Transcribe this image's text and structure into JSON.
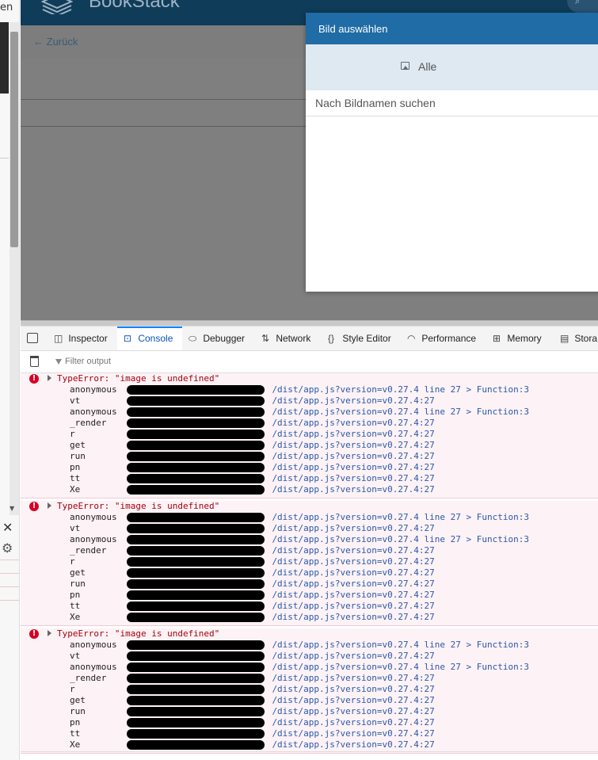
{
  "left_window": {
    "partial_label": "en",
    "close_glyph": "✕",
    "settings_glyph": "⚙"
  },
  "bookstack": {
    "app_title": "BookStack",
    "search_glyph": "⌕",
    "back_label": "Zurück",
    "back_arrow": "←"
  },
  "modal": {
    "title": "Bild auswählen",
    "tab_label": "Alle",
    "tab_icon": "image-icon",
    "search_placeholder": "Nach Bildnamen suchen"
  },
  "devtools": {
    "tabs": [
      {
        "label": "Inspector",
        "icon": "inspector-icon",
        "glyph": "◫"
      },
      {
        "label": "Console",
        "icon": "console-icon",
        "glyph": "⊡"
      },
      {
        "label": "Debugger",
        "icon": "debugger-icon",
        "glyph": "⬭"
      },
      {
        "label": "Network",
        "icon": "network-icon",
        "glyph": "⇅"
      },
      {
        "label": "Style Editor",
        "icon": "style-editor-icon",
        "glyph": "{}"
      },
      {
        "label": "Performance",
        "icon": "performance-icon",
        "glyph": "◠"
      },
      {
        "label": "Memory",
        "icon": "memory-icon",
        "glyph": "⊞"
      },
      {
        "label": "Stora",
        "icon": "storage-icon",
        "glyph": "▤"
      }
    ],
    "active_tab": "Console",
    "filter_placeholder": "Filter output"
  },
  "console": {
    "errors": [
      {
        "message": "TypeError: \"image is undefined\"",
        "frames": [
          {
            "fn": "anonymous",
            "location": "/dist/app.js?version=v0.27.4 line 27 > Function:3"
          },
          {
            "fn": "vt",
            "location": "/dist/app.js?version=v0.27.4:27"
          },
          {
            "fn": "anonymous",
            "location": "/dist/app.js?version=v0.27.4 line 27 > Function:3"
          },
          {
            "fn": "_render",
            "location": "/dist/app.js?version=v0.27.4:27"
          },
          {
            "fn": "r",
            "location": "/dist/app.js?version=v0.27.4:27"
          },
          {
            "fn": "get",
            "location": "/dist/app.js?version=v0.27.4:27"
          },
          {
            "fn": "run",
            "location": "/dist/app.js?version=v0.27.4:27"
          },
          {
            "fn": "pn",
            "location": "/dist/app.js?version=v0.27.4:27"
          },
          {
            "fn": "tt",
            "location": "/dist/app.js?version=v0.27.4:27"
          },
          {
            "fn": "Xe",
            "location": "/dist/app.js?version=v0.27.4:27"
          }
        ]
      },
      {
        "message": "TypeError: \"image is undefined\"",
        "frames": [
          {
            "fn": "anonymous",
            "location": "/dist/app.js?version=v0.27.4 line 27 > Function:3"
          },
          {
            "fn": "vt",
            "location": "/dist/app.js?version=v0.27.4:27"
          },
          {
            "fn": "anonymous",
            "location": "/dist/app.js?version=v0.27.4 line 27 > Function:3"
          },
          {
            "fn": "_render",
            "location": "/dist/app.js?version=v0.27.4:27"
          },
          {
            "fn": "r",
            "location": "/dist/app.js?version=v0.27.4:27"
          },
          {
            "fn": "get",
            "location": "/dist/app.js?version=v0.27.4:27"
          },
          {
            "fn": "run",
            "location": "/dist/app.js?version=v0.27.4:27"
          },
          {
            "fn": "pn",
            "location": "/dist/app.js?version=v0.27.4:27"
          },
          {
            "fn": "tt",
            "location": "/dist/app.js?version=v0.27.4:27"
          },
          {
            "fn": "Xe",
            "location": "/dist/app.js?version=v0.27.4:27"
          }
        ]
      },
      {
        "message": "TypeError: \"image is undefined\"",
        "frames": [
          {
            "fn": "anonymous",
            "location": "/dist/app.js?version=v0.27.4 line 27 > Function:3"
          },
          {
            "fn": "vt",
            "location": "/dist/app.js?version=v0.27.4:27"
          },
          {
            "fn": "anonymous",
            "location": "/dist/app.js?version=v0.27.4 line 27 > Function:3"
          },
          {
            "fn": "_render",
            "location": "/dist/app.js?version=v0.27.4:27"
          },
          {
            "fn": "r",
            "location": "/dist/app.js?version=v0.27.4:27"
          },
          {
            "fn": "get",
            "location": "/dist/app.js?version=v0.27.4:27"
          },
          {
            "fn": "run",
            "location": "/dist/app.js?version=v0.27.4:27"
          },
          {
            "fn": "pn",
            "location": "/dist/app.js?version=v0.27.4:27"
          },
          {
            "fn": "tt",
            "location": "/dist/app.js?version=v0.27.4:27"
          },
          {
            "fn": "Xe",
            "location": "/dist/app.js?version=v0.27.4:27"
          }
        ]
      }
    ]
  },
  "colors": {
    "bookstack_header": "#0f3c59",
    "modal_header": "#1f6ca6",
    "console_error_bg": "#fdf2f5",
    "console_error_text": "#a4000f",
    "stack_link": "#2b5aa8",
    "active_tab": "#0a84ff"
  }
}
